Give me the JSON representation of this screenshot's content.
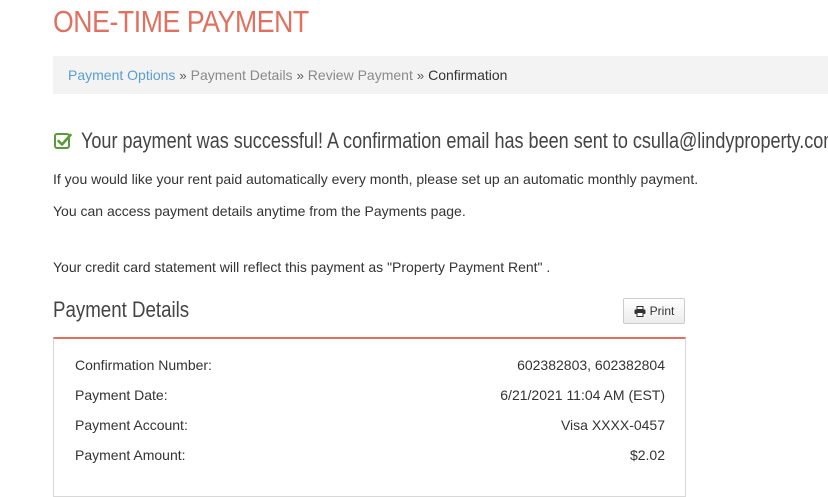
{
  "page": {
    "title": "ONE-TIME PAYMENT"
  },
  "breadcrumb": {
    "items": [
      {
        "label": "Payment Options",
        "state": "link"
      },
      {
        "label": "Payment Details",
        "state": "inactive"
      },
      {
        "label": "Review Payment",
        "state": "inactive"
      },
      {
        "label": "Confirmation",
        "state": "current"
      }
    ],
    "separator": "»"
  },
  "success": {
    "icon": "check-square-icon",
    "message": "Your payment was successful! A confirmation email has been sent to csulla@lindyproperty.com."
  },
  "info": {
    "autopay": "If you would like your rent paid automatically every month, please set up an automatic monthly payment.",
    "access": "You can access payment details anytime from the Payments page.",
    "statement": "Your credit card statement will reflect this payment as \"Property Payment Rent\" ."
  },
  "details": {
    "heading": "Payment Details",
    "print_label": "Print",
    "rows": [
      {
        "label": "Confirmation Number:",
        "value": "602382803, 602382804"
      },
      {
        "label": "Payment Date:",
        "value": "6/21/2021 11:04 AM (EST)"
      },
      {
        "label": "Payment Account:",
        "value": "Visa XXXX-0457"
      },
      {
        "label": "Payment Amount:",
        "value": "$2.02"
      }
    ]
  },
  "colors": {
    "accent": "#e07060",
    "link": "#5a9ecf",
    "success": "#5a9a3c"
  }
}
